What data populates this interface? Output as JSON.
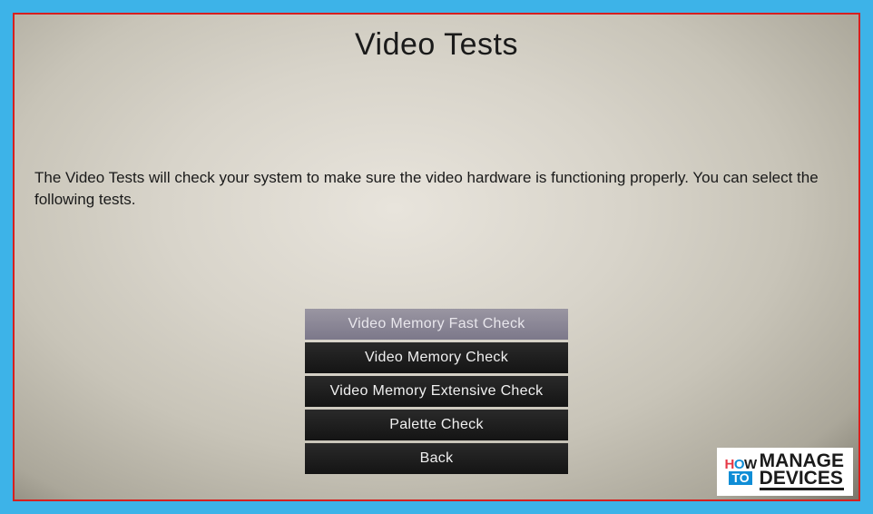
{
  "title": "Video Tests",
  "description": "The Video Tests will check your system to make sure the video hardware is functioning properly. You can select the following tests.",
  "buttons": [
    {
      "label": "Video Memory Fast Check",
      "selected": true
    },
    {
      "label": "Video Memory Check",
      "selected": false
    },
    {
      "label": "Video Memory Extensive Check",
      "selected": false
    },
    {
      "label": "Palette Check",
      "selected": false
    },
    {
      "label": "Back",
      "selected": false
    }
  ],
  "watermark": {
    "how": "HOW",
    "to": "TO",
    "line1": "MANAGE",
    "line2": "DEVICES"
  }
}
